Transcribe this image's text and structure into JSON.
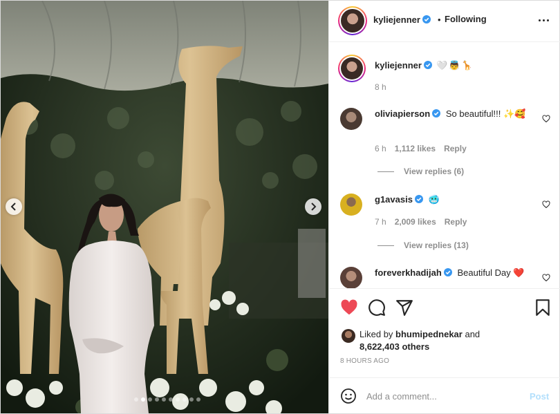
{
  "post": {
    "username": "kyliejenner",
    "follow_status": "Following",
    "separator": "•",
    "caption_emojis": "🤍👼🦒",
    "caption_time": "8 h",
    "carousel_total": 10,
    "carousel_active": 2
  },
  "comments": [
    {
      "username": "oliviapierson",
      "text": "So beautiful!!! ✨🥰",
      "time": "6 h",
      "likes": "1,112 likes",
      "reply": "Reply",
      "view_replies": "View replies (6)"
    },
    {
      "username": "g1avasis",
      "text": "🥶",
      "time": "7 h",
      "likes": "2,009 likes",
      "reply": "Reply",
      "view_replies": "View replies (13)"
    },
    {
      "username": "foreverkhadijah",
      "text": "Beautiful Day ❤️"
    }
  ],
  "likes": {
    "prefix": "Liked by",
    "user": "bhumipednekar",
    "connector": "and",
    "others": "8,622,403 others"
  },
  "time_ago": "8 HOURS AGO",
  "add_comment": {
    "placeholder": "Add a comment...",
    "post_label": "Post"
  },
  "colors": {
    "like_red": "#ed4956",
    "verified_blue": "#3897f0",
    "post_disabled": "#b2dffc",
    "muted_text": "#8e8e8e"
  },
  "icons": [
    "chevron-left-icon",
    "chevron-right-icon",
    "verified-icon",
    "more-icon",
    "heart-filled-icon",
    "comment-icon",
    "share-icon",
    "bookmark-icon",
    "heart-outline-icon",
    "emoji-icon"
  ]
}
